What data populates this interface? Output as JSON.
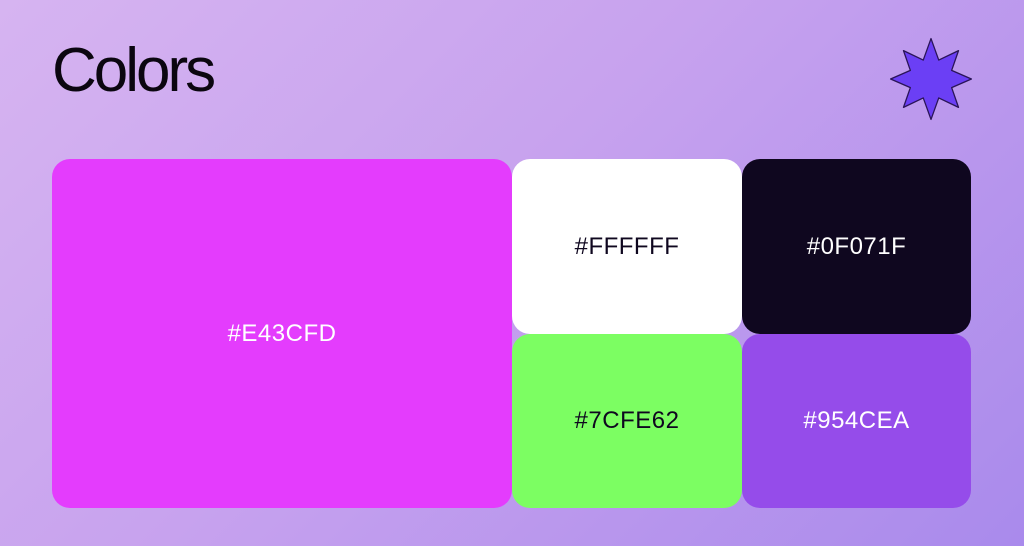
{
  "header": {
    "title": "Colors"
  },
  "decor": {
    "star_fill": "#6b3ff5",
    "star_stroke": "#2a1457"
  },
  "swatches": [
    {
      "label": "#E43CFD",
      "color": "#E43CFD",
      "text_color": "#FFFFFF"
    },
    {
      "label": "#FFFFFF",
      "color": "#FFFFFF",
      "text_color": "#0F071F"
    },
    {
      "label": "#0F071F",
      "color": "#0F071F",
      "text_color": "#FFFFFF"
    },
    {
      "label": "#7CFE62",
      "color": "#7CFE62",
      "text_color": "#0F071F"
    },
    {
      "label": "#954CEA",
      "color": "#954CEA",
      "text_color": "#FFFFFF"
    }
  ]
}
